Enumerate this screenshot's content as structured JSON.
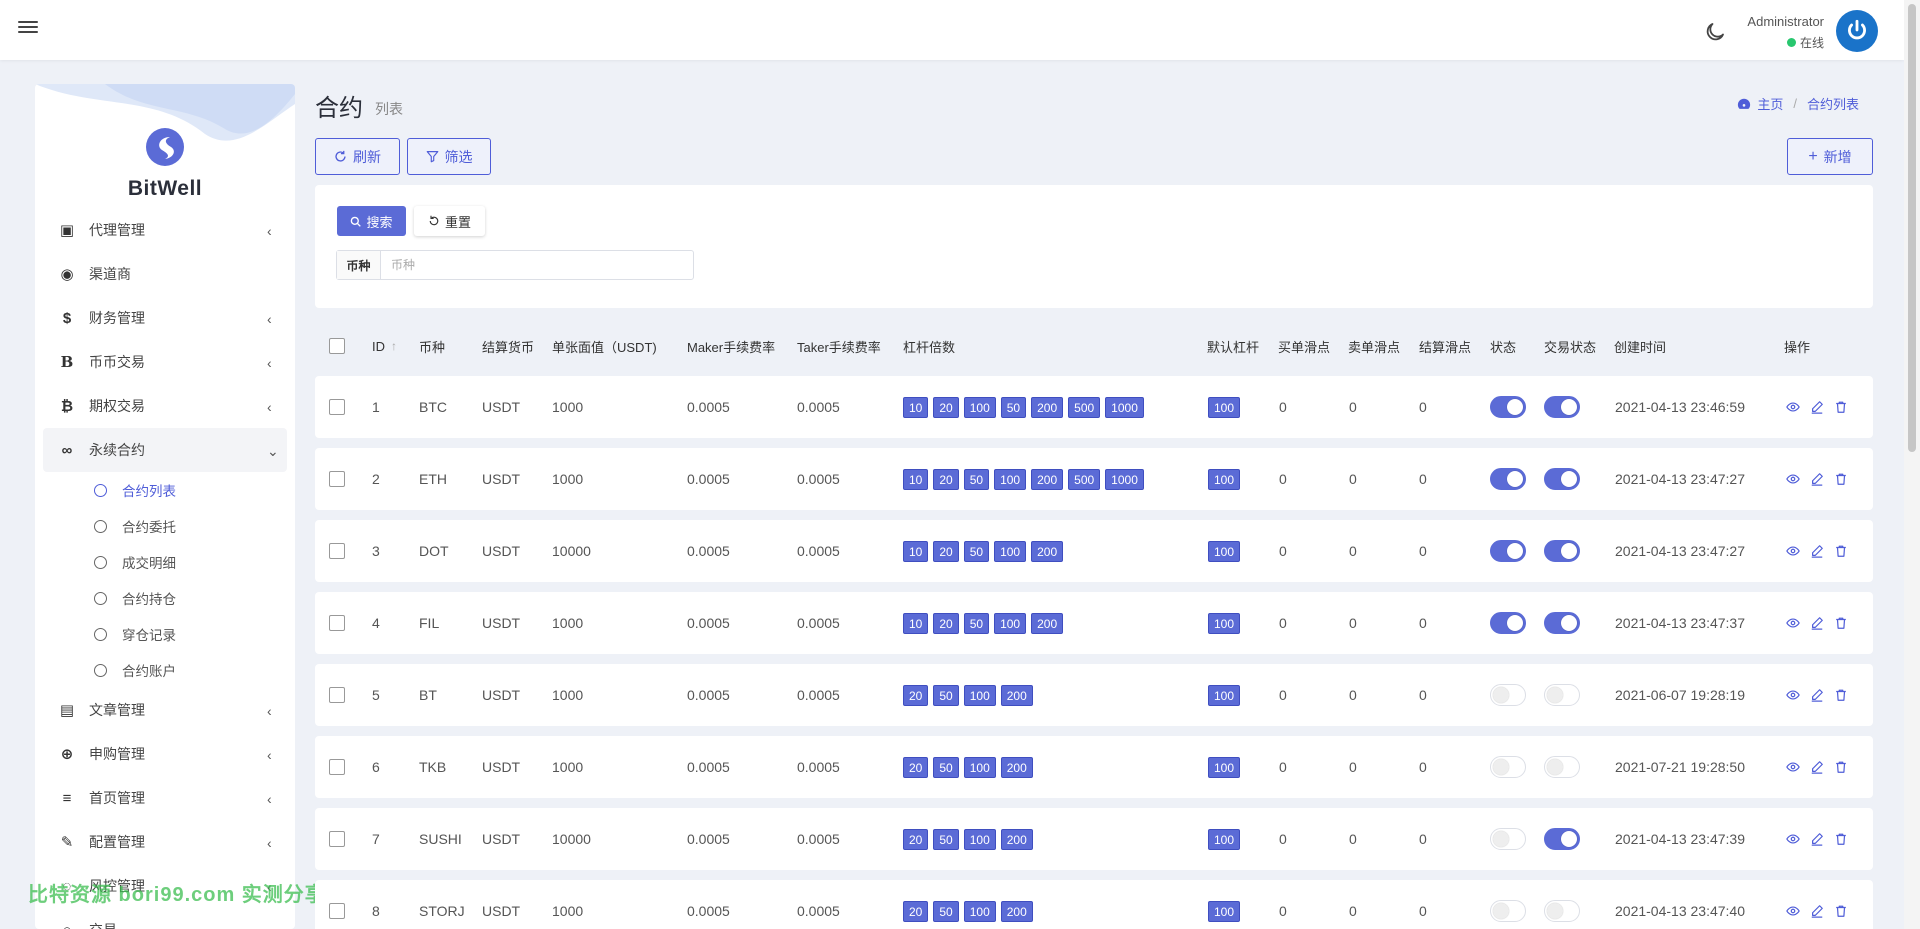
{
  "header": {
    "admin_name": "Administrator",
    "status": "在线"
  },
  "sidebar": {
    "brand": "BitWell",
    "menu": [
      {
        "label": "代理管理",
        "icon": "id-card-icon",
        "has_children": true
      },
      {
        "label": "渠道商",
        "icon": "user-circle-icon",
        "has_children": false
      },
      {
        "label": "财务管理",
        "icon": "dollar-icon",
        "has_children": true
      },
      {
        "label": "币币交易",
        "icon": "letter-b-icon",
        "has_children": true
      },
      {
        "label": "期权交易",
        "icon": "bitcoin-icon",
        "has_children": true
      },
      {
        "label": "永续合约",
        "icon": "link-icon",
        "has_children": true,
        "open": true
      }
    ],
    "submenu": [
      {
        "label": "合约列表",
        "active": true
      },
      {
        "label": "合约委托",
        "active": false
      },
      {
        "label": "成交明细",
        "active": false
      },
      {
        "label": "合约持仓",
        "active": false
      },
      {
        "label": "穿仓记录",
        "active": false
      },
      {
        "label": "合约账户",
        "active": false
      }
    ],
    "menu_after": [
      {
        "label": "文章管理",
        "icon": "newspaper-icon",
        "has_children": true
      },
      {
        "label": "申购管理",
        "icon": "lifebuoy-icon",
        "has_children": true
      },
      {
        "label": "首页管理",
        "icon": "bars-icon",
        "has_children": true
      },
      {
        "label": "配置管理",
        "icon": "wrench-icon",
        "has_children": true
      },
      {
        "label": "风控管理",
        "icon": "shield-icon",
        "has_children": true
      },
      {
        "label": "交易",
        "icon": "circle-icon",
        "has_children": true
      }
    ]
  },
  "watermark": "比特资源 bori99.com 实测分享",
  "page": {
    "title": "合约",
    "subtitle": "列表",
    "breadcrumb": [
      "主页",
      "合约列表"
    ]
  },
  "toolbar": {
    "refresh": "刷新",
    "filter": "筛选",
    "add": "新增"
  },
  "filter": {
    "search": "搜索",
    "reset": "重置",
    "field_label": "币种",
    "field_placeholder": "币种",
    "field_value": ""
  },
  "table": {
    "columns": [
      "ID",
      "币种",
      "结算货币",
      "单张面值（USDT)",
      "Maker手续费率",
      "Taker手续费率",
      "杠杆倍数",
      "默认杠杆",
      "买单滑点",
      "卖单滑点",
      "结算滑点",
      "状态",
      "交易状态",
      "创建时间",
      "操作"
    ],
    "rows": [
      {
        "id": "1",
        "coin": "BTC",
        "settle": "USDT",
        "face": "1000",
        "maker": "0.0005",
        "taker": "0.0005",
        "leverage": [
          "10",
          "20",
          "100",
          "50",
          "200",
          "500",
          "1000"
        ],
        "default_lev": "100",
        "buy_slip": "0",
        "sell_slip": "0",
        "settle_slip": "0",
        "status": true,
        "trade_status": true,
        "created": "2021-04-13 23:46:59"
      },
      {
        "id": "2",
        "coin": "ETH",
        "settle": "USDT",
        "face": "1000",
        "maker": "0.0005",
        "taker": "0.0005",
        "leverage": [
          "10",
          "20",
          "50",
          "100",
          "200",
          "500",
          "1000"
        ],
        "default_lev": "100",
        "buy_slip": "0",
        "sell_slip": "0",
        "settle_slip": "0",
        "status": true,
        "trade_status": true,
        "created": "2021-04-13 23:47:27"
      },
      {
        "id": "3",
        "coin": "DOT",
        "settle": "USDT",
        "face": "10000",
        "maker": "0.0005",
        "taker": "0.0005",
        "leverage": [
          "10",
          "20",
          "50",
          "100",
          "200"
        ],
        "default_lev": "100",
        "buy_slip": "0",
        "sell_slip": "0",
        "settle_slip": "0",
        "status": true,
        "trade_status": true,
        "created": "2021-04-13 23:47:27"
      },
      {
        "id": "4",
        "coin": "FIL",
        "settle": "USDT",
        "face": "1000",
        "maker": "0.0005",
        "taker": "0.0005",
        "leverage": [
          "10",
          "20",
          "50",
          "100",
          "200"
        ],
        "default_lev": "100",
        "buy_slip": "0",
        "sell_slip": "0",
        "settle_slip": "0",
        "status": true,
        "trade_status": true,
        "created": "2021-04-13 23:47:37"
      },
      {
        "id": "5",
        "coin": "BT",
        "settle": "USDT",
        "face": "1000",
        "maker": "0.0005",
        "taker": "0.0005",
        "leverage": [
          "20",
          "50",
          "100",
          "200"
        ],
        "default_lev": "100",
        "buy_slip": "0",
        "sell_slip": "0",
        "settle_slip": "0",
        "status": false,
        "trade_status": false,
        "created": "2021-06-07 19:28:19"
      },
      {
        "id": "6",
        "coin": "TKB",
        "settle": "USDT",
        "face": "1000",
        "maker": "0.0005",
        "taker": "0.0005",
        "leverage": [
          "20",
          "50",
          "100",
          "200"
        ],
        "default_lev": "100",
        "buy_slip": "0",
        "sell_slip": "0",
        "settle_slip": "0",
        "status": false,
        "trade_status": false,
        "created": "2021-07-21 19:28:50"
      },
      {
        "id": "7",
        "coin": "SUSHI",
        "settle": "USDT",
        "face": "10000",
        "maker": "0.0005",
        "taker": "0.0005",
        "leverage": [
          "20",
          "50",
          "100",
          "200"
        ],
        "default_lev": "100",
        "buy_slip": "0",
        "sell_slip": "0",
        "settle_slip": "0",
        "status": false,
        "trade_status": true,
        "created": "2021-04-13 23:47:39"
      },
      {
        "id": "8",
        "coin": "STORJ",
        "settle": "USDT",
        "face": "1000",
        "maker": "0.0005",
        "taker": "0.0005",
        "leverage": [
          "20",
          "50",
          "100",
          "200"
        ],
        "default_lev": "100",
        "buy_slip": "0",
        "sell_slip": "0",
        "settle_slip": "0",
        "status": false,
        "trade_status": false,
        "created": "2021-04-13 23:47:40"
      }
    ]
  },
  "colors": {
    "accent": "#5b6bd6",
    "online": "#28c76f",
    "avatar": "#1a73c9"
  }
}
